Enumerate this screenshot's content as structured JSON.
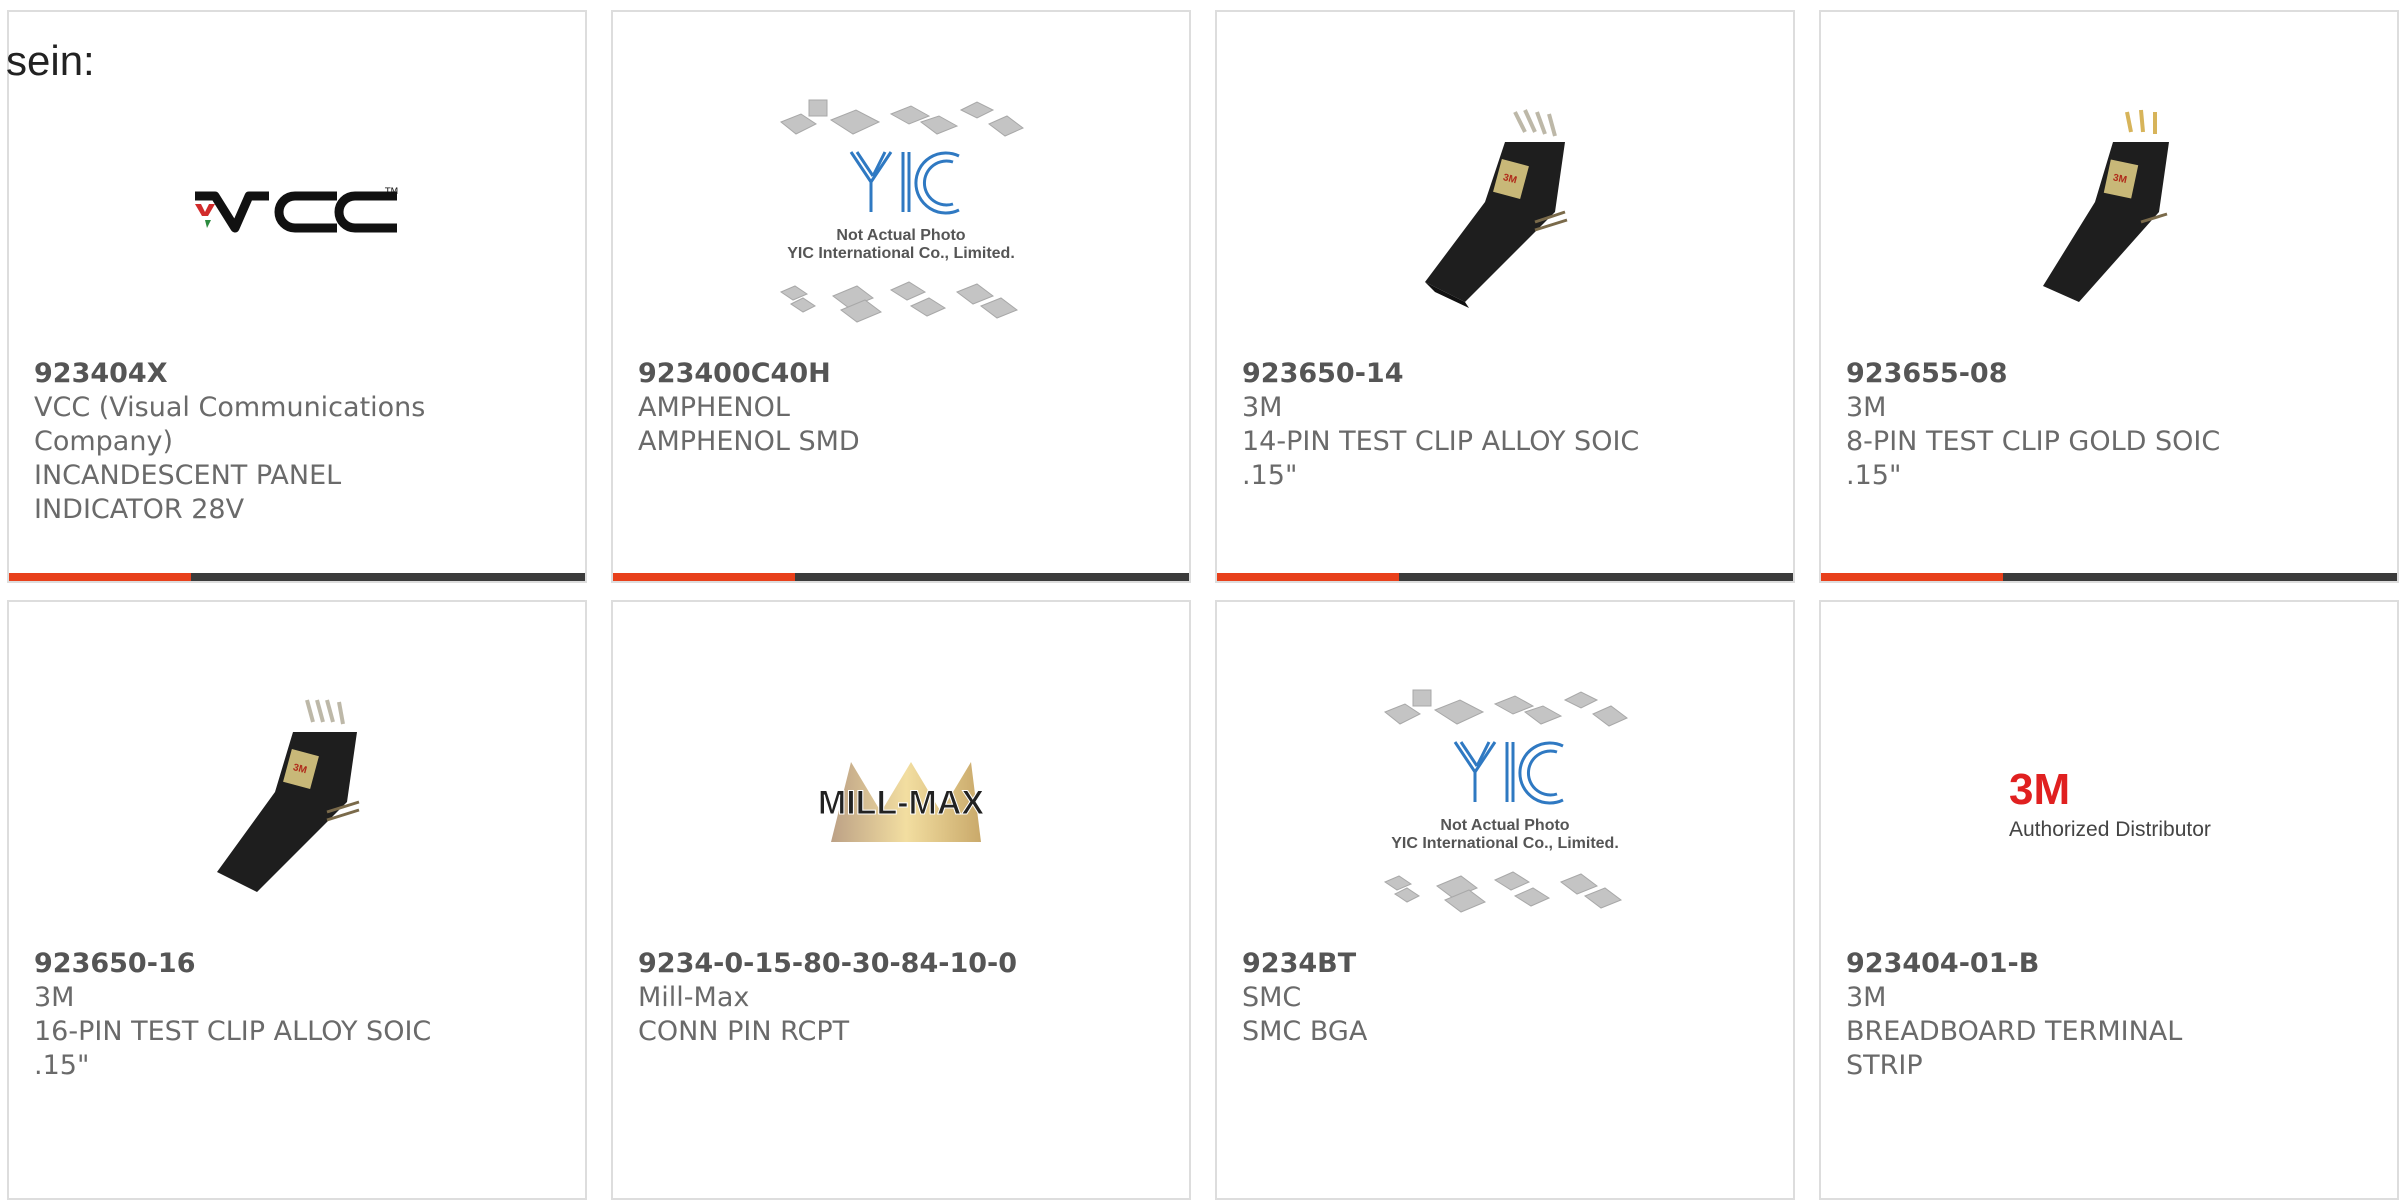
{
  "lead_text": "sein:",
  "colors": {
    "accent": "#e8401b",
    "bar": "#3b3b3b",
    "border": "#dddddd",
    "text": "#6a6a6a"
  },
  "products": [
    {
      "part": "923404X",
      "manufacturer": "VCC (Visual Communications Company)",
      "description": "INCANDESCENT PANEL INDICATOR 28V",
      "image": "vcc-logo",
      "logo_text": "VCC",
      "logo_tm": "TM"
    },
    {
      "part": "923400C40H",
      "manufacturer": "AMPHENOL",
      "description": "AMPHENOL SMD",
      "image": "yic-placeholder",
      "logo_text": "YIC",
      "caption1": "Not Actual Photo",
      "caption2": "YIC International Co., Limited."
    },
    {
      "part": "923650-14",
      "manufacturer": "3M",
      "description": "14-PIN TEST CLIP ALLOY SOIC .15\"",
      "image": "test-clip-photo"
    },
    {
      "part": "923655-08",
      "manufacturer": "3M",
      "description": "8-PIN TEST CLIP GOLD SOIC .15\"",
      "image": "test-clip-gold-photo"
    },
    {
      "part": "923650-16",
      "manufacturer": "3M",
      "description": "16-PIN TEST CLIP ALLOY SOIC .15\"",
      "image": "test-clip-photo"
    },
    {
      "part": "9234-0-15-80-30-84-10-0",
      "manufacturer": "Mill-Max",
      "description": "CONN PIN RCPT",
      "image": "mill-max-logo",
      "logo_text": "MILL-MAX"
    },
    {
      "part": "9234BT",
      "manufacturer": "SMC",
      "description": "SMC BGA",
      "image": "yic-placeholder",
      "logo_text": "YIC",
      "caption1": "Not Actual Photo",
      "caption2": "YIC International Co., Limited."
    },
    {
      "part": "923404-01-B",
      "manufacturer": "3M",
      "description": "BREADBOARD TERMINAL STRIP",
      "image": "3m-authorized-logo",
      "logo_text": "3M",
      "caption1": "Authorized Distributor"
    }
  ]
}
